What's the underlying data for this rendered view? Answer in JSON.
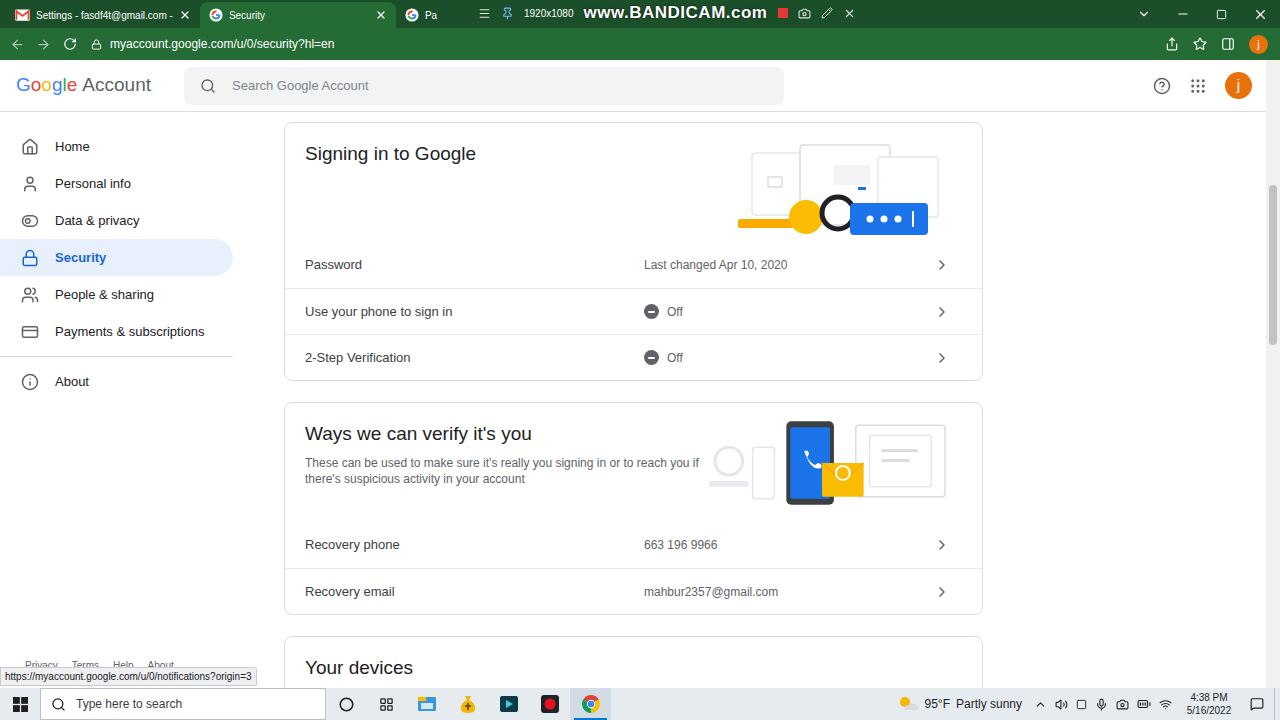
{
  "browser": {
    "tabs": [
      {
        "label": "Settings - fasdf4t@gmail.com -",
        "kind": "gmail",
        "selected": false
      },
      {
        "label": "Security",
        "kind": "google",
        "selected": true
      },
      {
        "label": "Pa",
        "kind": "google",
        "selected": false
      }
    ],
    "recorder": {
      "resolution": "1920x1080",
      "watermark": "www.BANDICAM.com"
    },
    "url": "myaccount.google.com/u/0/security?hl=en",
    "profile": "j"
  },
  "header": {
    "brand": "Google",
    "product": "Account",
    "search_placeholder": "Search Google Account",
    "avatar": "j"
  },
  "sidebar": {
    "items": [
      {
        "label": "Home",
        "selected": false
      },
      {
        "label": "Personal info",
        "selected": false
      },
      {
        "label": "Data & privacy",
        "selected": false
      },
      {
        "label": "Security",
        "selected": true
      },
      {
        "label": "People & sharing",
        "selected": false
      },
      {
        "label": "Payments & subscriptions",
        "selected": false
      }
    ],
    "bottom_items": [
      {
        "label": "About",
        "selected": false
      }
    ],
    "footer_links": [
      "Privacy",
      "Terms",
      "Help",
      "About"
    ]
  },
  "status_url": "https://myaccount.google.com/u/0/notifications?origin=3",
  "sections": [
    {
      "title": "Signing in to Google",
      "kind": "signin",
      "rows": [
        {
          "label": "Password",
          "value": "Last changed Apr 10, 2020",
          "kind": "text"
        },
        {
          "label": "Use your phone to sign in",
          "value": "Off",
          "kind": "status",
          "on": false
        },
        {
          "label": "2-Step Verification",
          "value": "Off",
          "kind": "status",
          "on": false
        }
      ]
    },
    {
      "title": "Ways we can verify it's you",
      "description": "These can be used to make sure it's really you signing in or to reach you if there's suspicious activity in your account",
      "kind": "verify",
      "rows": [
        {
          "label": "Recovery phone",
          "value": "663 196 9966",
          "kind": "text"
        },
        {
          "label": "Recovery email",
          "value": "mahbur2357@gmail.com",
          "kind": "text"
        }
      ]
    },
    {
      "title": "Your devices",
      "kind": "devices",
      "rows": []
    }
  ],
  "taskbar": {
    "search_placeholder": "Type here to search",
    "apps": [
      {
        "kind": "explorer",
        "selected": false
      },
      {
        "kind": "coin",
        "selected": false
      },
      {
        "kind": "media",
        "selected": false
      },
      {
        "kind": "recorder",
        "selected": false
      },
      {
        "kind": "chrome",
        "selected": true
      }
    ],
    "weather": {
      "temperature": "95°F",
      "condition": "Partly sunny"
    },
    "time": "4:38 PM",
    "date": "5/16/2022"
  }
}
